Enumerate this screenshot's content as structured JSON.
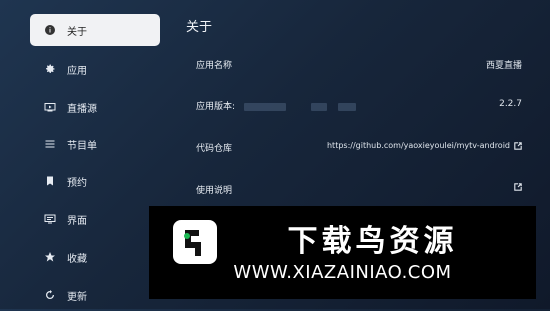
{
  "sidebar": {
    "items": [
      {
        "label": "关于",
        "icon": "info-icon",
        "active": true
      },
      {
        "label": "应用",
        "icon": "gear-icon"
      },
      {
        "label": "直播源",
        "icon": "tv-icon"
      },
      {
        "label": "节目单",
        "icon": "menu-icon"
      },
      {
        "label": "预约",
        "icon": "bookmark-icon"
      },
      {
        "label": "界面",
        "icon": "screen-icon"
      },
      {
        "label": "收藏",
        "icon": "star-icon"
      },
      {
        "label": "更新",
        "icon": "refresh-icon"
      }
    ]
  },
  "main": {
    "title": "关于",
    "rows": [
      {
        "label": "应用名称",
        "value": "西夏直播"
      },
      {
        "label": "应用版本:",
        "value": "2.2.7"
      },
      {
        "label": "代码仓库",
        "value": "https://github.com/yaoxieyoulei/mytv-android"
      },
      {
        "label": "使用说明",
        "value": ""
      }
    ]
  },
  "watermark": {
    "title": "下载鸟资源",
    "url": "WWW.XIAZAINIAO.COM"
  }
}
